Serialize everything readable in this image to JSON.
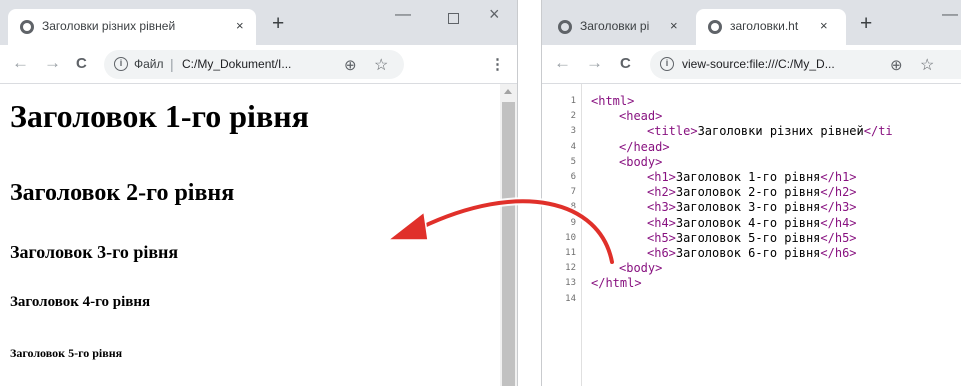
{
  "left_window": {
    "tab": {
      "title": "Заголовки різних рівней",
      "close": "×"
    },
    "new_tab": "+",
    "controls": {
      "minimize": "—",
      "close": "×"
    },
    "toolbar": {
      "back": "←",
      "forward": "→",
      "reload": "C",
      "scheme_label": "Файл",
      "url": "C:/My_Dokument/I...",
      "zoom_icon": "⊕",
      "star_icon": "☆",
      "menu_icon": "⋮"
    },
    "page": {
      "h1": "Заголовок 1-го рівня",
      "h2": "Заголовок 2-го рівня",
      "h3": "Заголовок 3-го рівня",
      "h4": "Заголовок 4-го рівня",
      "h5": "Заголовок 5-го рівня"
    }
  },
  "right_window": {
    "tabs": [
      {
        "title": "Заголовки рі",
        "close": "×"
      },
      {
        "title": "заголовки.ht",
        "close": "×"
      }
    ],
    "new_tab": "+",
    "controls": {
      "minimize": "—"
    },
    "toolbar": {
      "back": "←",
      "forward": "→",
      "reload": "C",
      "url": "view-source:file:///C:/My_D...",
      "zoom_icon": "⊕",
      "star_icon": "☆"
    },
    "source_lines": [
      {
        "num": "1",
        "tag_open": "<html>",
        "text": "",
        "tag_close": ""
      },
      {
        "num": "2",
        "tag_open": "<head>",
        "text": "",
        "tag_close": ""
      },
      {
        "num": "3",
        "tag_open": "<title>",
        "text": "Заголовки різних рівней",
        "tag_close": "</ti"
      },
      {
        "num": "4",
        "tag_open": "</head>",
        "text": "",
        "tag_close": ""
      },
      {
        "num": "5",
        "tag_open": "<body>",
        "text": "",
        "tag_close": ""
      },
      {
        "num": "6",
        "tag_open": "<h1>",
        "text": "Заголовок 1-го рівня",
        "tag_close": "</h1>"
      },
      {
        "num": "7",
        "tag_open": "<h2>",
        "text": "Заголовок 2-го рівня",
        "tag_close": "</h2>"
      },
      {
        "num": "8",
        "tag_open": "<h3>",
        "text": "Заголовок 3-го рівня",
        "tag_close": "</h3>"
      },
      {
        "num": "9",
        "tag_open": "<h4>",
        "text": "Заголовок 4-го рівня",
        "tag_close": "</h4>"
      },
      {
        "num": "10",
        "tag_open": "<h5>",
        "text": "Заголовок 5-го рівня",
        "tag_close": "</h5>"
      },
      {
        "num": "11",
        "tag_open": "<h6>",
        "text": "Заголовок 6-го рівня",
        "tag_close": "</h6>"
      },
      {
        "num": "12",
        "tag_open": "<body>",
        "text": "",
        "tag_close": ""
      },
      {
        "num": "13",
        "tag_open": "</html>",
        "text": "",
        "tag_close": ""
      },
      {
        "num": "14",
        "tag_open": "",
        "text": "",
        "tag_close": ""
      }
    ]
  },
  "colors": {
    "tag": "#881280",
    "arrow": "#e0302a",
    "tabstrip": "#dee1e6"
  }
}
